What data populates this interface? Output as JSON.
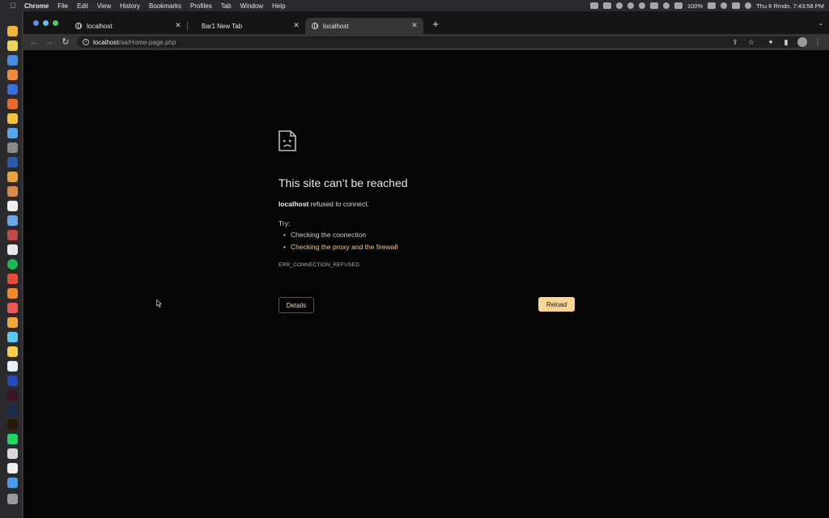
{
  "menubar": {
    "app_name": "Chrome",
    "menus": [
      "File",
      "Edit",
      "View",
      "History",
      "Bookmarks",
      "Profiles",
      "Tab",
      "Window",
      "Help"
    ],
    "battery": "100%",
    "datetime": "Thu 6 Rmdn. 7:43:58 PM"
  },
  "tabs": [
    {
      "title": "localhost",
      "active": false
    },
    {
      "title": "Bar1 New Tab",
      "active": false
    },
    {
      "title": "localhost",
      "active": true
    }
  ],
  "toolbar": {
    "url_host": "localhost",
    "url_path": "/aa/Home-page.php"
  },
  "error": {
    "title": "This site can’t be reached",
    "host": "localhost",
    "message": " refused to connect.",
    "try_label": "Try:",
    "suggestions": [
      {
        "text": "Checking the connection",
        "link": false
      },
      {
        "text": "Checking the proxy and the firewall",
        "link": true
      }
    ],
    "code": "ERR_CONNECTION_REFUSED",
    "details_label": "Details",
    "reload_label": "Reload"
  },
  "colors": {
    "accent": "#fbd596",
    "link": "#f7c98b",
    "background": "#050505"
  }
}
